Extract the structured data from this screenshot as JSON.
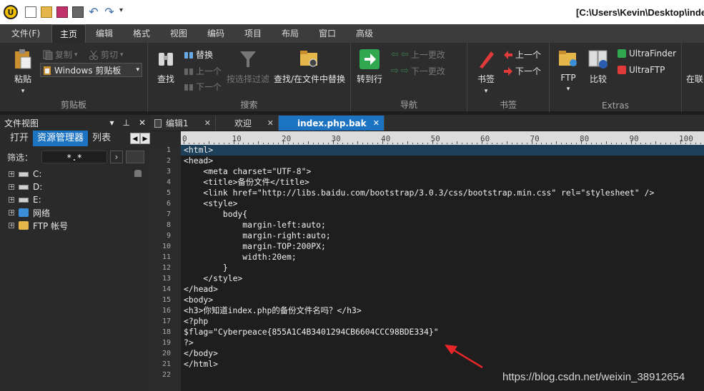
{
  "title_bar": {
    "path": "[C:\\Users\\Kevin\\Desktop\\inde"
  },
  "menu": [
    "文件(F)",
    "主页",
    "编辑",
    "格式",
    "视图",
    "编码",
    "项目",
    "布局",
    "窗口",
    "高级"
  ],
  "menu_active": "主页",
  "ribbon": {
    "clipboard": {
      "label": "剪贴板",
      "paste": "粘贴",
      "copy": "复制",
      "cut": "剪切",
      "dropdown": "Windows 剪贴板"
    },
    "search": {
      "label": "搜索",
      "find": "查找",
      "replace": "替换",
      "prev": "上一个",
      "next": "下一个",
      "filter": "按选择过滤",
      "find_in_files": "查找/在文件中替换"
    },
    "nav": {
      "label": "导航",
      "goto": "转到行",
      "prev_change": "上一更改",
      "next_change": "下一更改"
    },
    "bookmarks": {
      "label": "书签",
      "bookmark": "书签",
      "prev": "上一个",
      "next": "下一个"
    },
    "extras": {
      "label": "Extras",
      "ftp": "FTP",
      "compare": "比较",
      "ultrafinder": "UltraFinder",
      "ultraftp": "UltraFTP",
      "more": "在联"
    }
  },
  "left_panel": {
    "title": "文件视图",
    "tabs": [
      "打开",
      "资源管理器",
      "列表"
    ],
    "active_tab": "资源管理器",
    "filter_label": "筛选：",
    "filter_value": "*.*",
    "tree": [
      "C:",
      "D:",
      "E:",
      "网络",
      "FTP 帐号"
    ]
  },
  "editor_tabs": [
    {
      "label": "编辑1",
      "active": false
    },
    {
      "label": "欢迎",
      "active": false
    },
    {
      "label": "index.php.bak",
      "active": true
    }
  ],
  "ruler_labels": [
    "0",
    "10",
    "20",
    "30",
    "40",
    "50",
    "60",
    "70",
    "80",
    "90",
    "100"
  ],
  "line_numbers": [
    "1",
    "2",
    "3",
    "4",
    "5",
    "6",
    "7",
    "8",
    "9",
    "10",
    "11",
    "12",
    "13",
    "14",
    "15",
    "16",
    "17",
    "18",
    "19",
    "20",
    "21",
    "22"
  ],
  "code_lines": [
    "<html>",
    "<head>",
    "    <meta charset=\"UTF-8\">",
    "    <title>备份文件</title>",
    "    <link href=\"http://libs.baidu.com/bootstrap/3.0.3/css/bootstrap.min.css\" rel=\"stylesheet\" />",
    "    <style>",
    "        body{",
    "            margin-left:auto;",
    "            margin-right:auto;",
    "            margin-TOP:200PX;",
    "            width:20em;",
    "        }",
    "    </style>",
    "</head>",
    "<body>",
    "<h3>你知道index.php的备份文件名吗？</h3>",
    "<?php",
    "$flag=\"Cyberpeace{855A1C4B3401294CB6604CCC98BDE334}\"",
    "?>",
    "</body>",
    "</html>",
    ""
  ],
  "watermark": "https://blog.csdn.net/weixin_38912654",
  "colors": {
    "accent": "#1c73c2",
    "arrow": "#e8262a"
  }
}
